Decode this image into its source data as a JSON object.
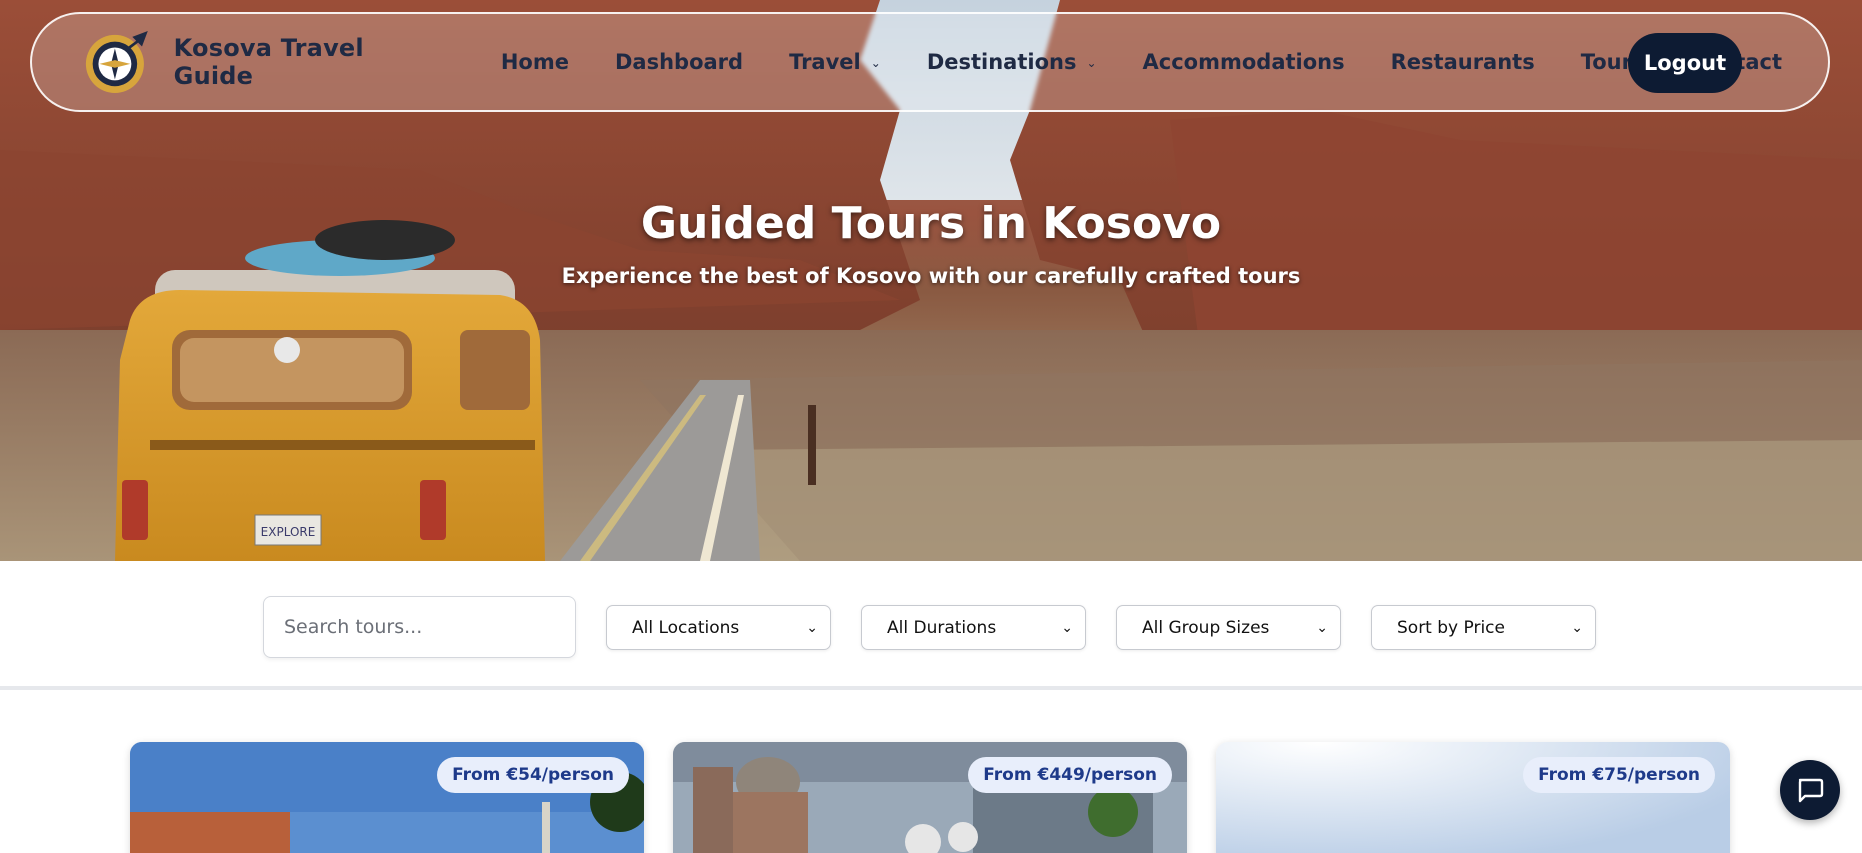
{
  "brand": {
    "name": "Kosova Travel Guide",
    "logo_icon": "compass-globe-plane-icon"
  },
  "nav": {
    "items": [
      {
        "label": "Home",
        "dropdown": false
      },
      {
        "label": "Dashboard",
        "dropdown": false
      },
      {
        "label": "Travel",
        "dropdown": true
      },
      {
        "label": "Destinations",
        "dropdown": true
      },
      {
        "label": "Accommodations",
        "dropdown": false
      },
      {
        "label": "Restaurants",
        "dropdown": false
      },
      {
        "label": "Tours",
        "dropdown": false
      },
      {
        "label": "Contact",
        "dropdown": false
      }
    ],
    "logout_label": "Logout"
  },
  "hero": {
    "title": "Guided Tours in Kosovo",
    "subtitle": "Experience the best of Kosovo with our carefully crafted tours",
    "van_plate": "EXPLORE"
  },
  "filters": {
    "search_placeholder": "Search tours...",
    "location": "All Locations",
    "duration": "All Durations",
    "group_size": "All Group Sizes",
    "sort": "Sort by Price"
  },
  "cards": [
    {
      "price": "From €54/person"
    },
    {
      "price": "From €449/person"
    },
    {
      "price": "From €75/person"
    }
  ],
  "colors": {
    "navy": "#0d1b33",
    "text_dark": "#1f2a44",
    "badge_bg": "#e8eefb",
    "badge_text": "#1e3a8a"
  },
  "chat": {
    "icon": "chat-bubble-icon"
  }
}
